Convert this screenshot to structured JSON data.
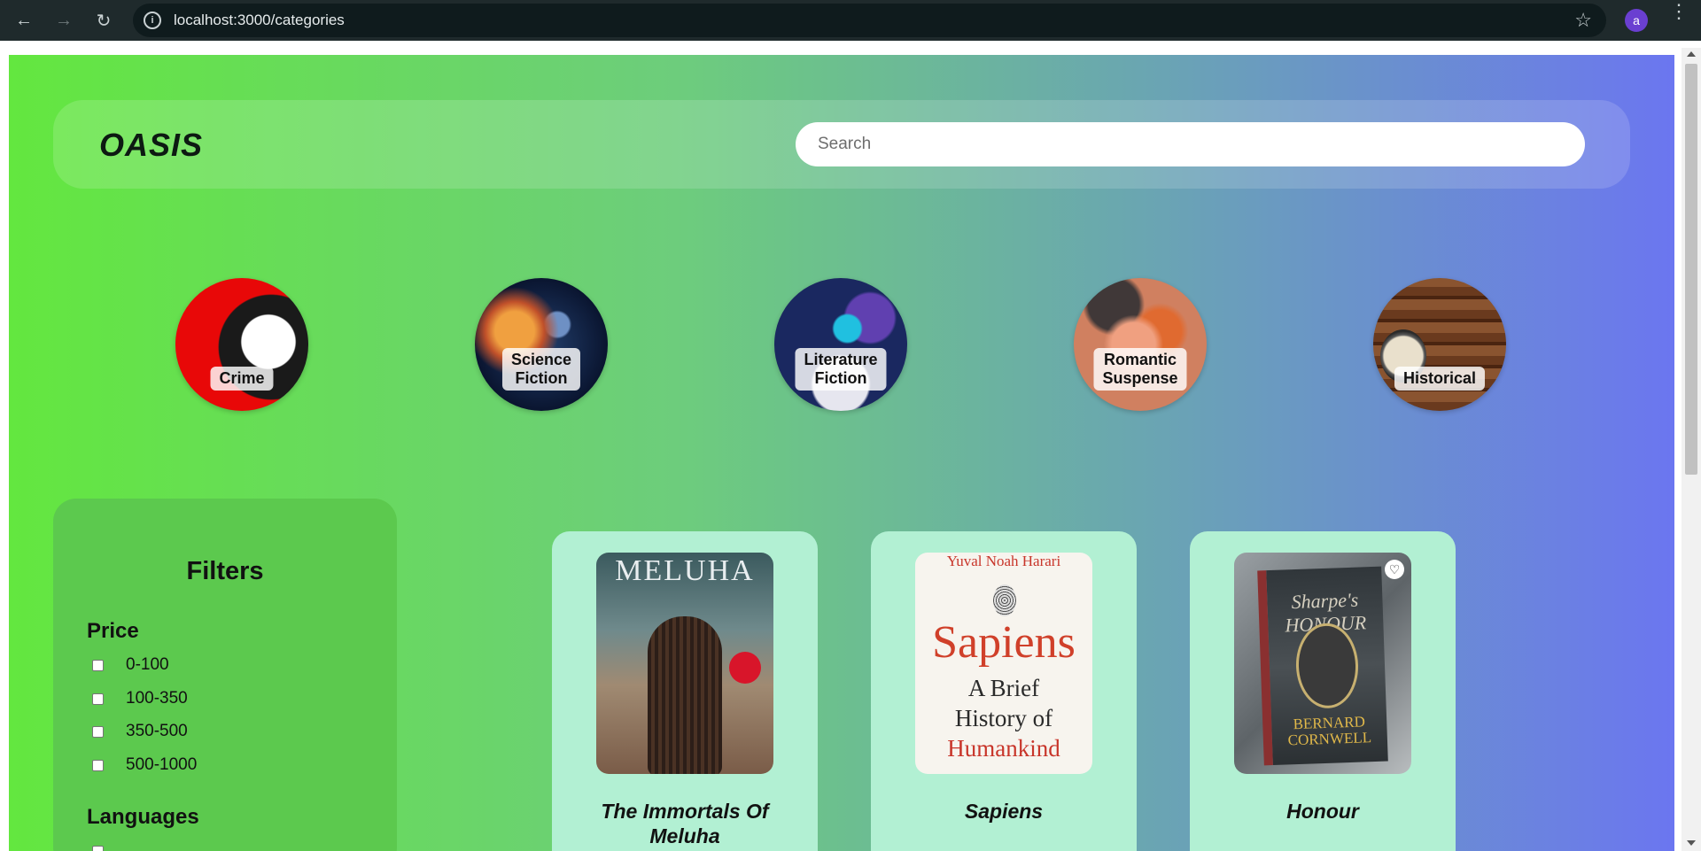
{
  "browser": {
    "url": "localhost:3000/categories",
    "profile_initial": "a",
    "back_glyph": "←",
    "forward_glyph": "→",
    "reload_glyph": "↻",
    "info_glyph": "i",
    "star_glyph": "☆",
    "menu_glyph": "⋮"
  },
  "header": {
    "logo": "OASIS",
    "search_placeholder": "Search"
  },
  "categories": [
    {
      "label": "Crime"
    },
    {
      "label": "Science Fiction",
      "line1": "Science",
      "line2": "Fiction"
    },
    {
      "label": "Literature Fiction",
      "line1": "Literature",
      "line2": "Fiction"
    },
    {
      "label": "Romantic Suspense",
      "line1": "Romantic",
      "line2": "Suspense"
    },
    {
      "label": "Historical"
    }
  ],
  "filters": {
    "title": "Filters",
    "price_heading": "Price",
    "price_options": [
      "0-100",
      "100-350",
      "350-500",
      "500-1000"
    ],
    "languages_heading": "Languages"
  },
  "products": [
    {
      "title": "The Immortals Of Meluha",
      "title_line1": "The Immortals Of",
      "title_line2": "Meluha",
      "cover_text": "MELUHA"
    },
    {
      "title": "Sapiens",
      "cover_author": "Yuval Noah Harari",
      "cover_title": "Sapiens",
      "cover_sub1": "A Brief",
      "cover_sub2": "History of",
      "cover_sub3": "Humankind"
    },
    {
      "title": "Honour",
      "cover_title": "Sharpe's HONOUR",
      "cover_author_line1": "BERNARD",
      "cover_author_line2": "CORNWELL",
      "heart_glyph": "♡"
    }
  ],
  "colors": {
    "gradient_start": "#63e73f",
    "gradient_end": "#6b76f0",
    "card_bg": "#b2f0d3",
    "filters_bg": "#5cc94e"
  }
}
